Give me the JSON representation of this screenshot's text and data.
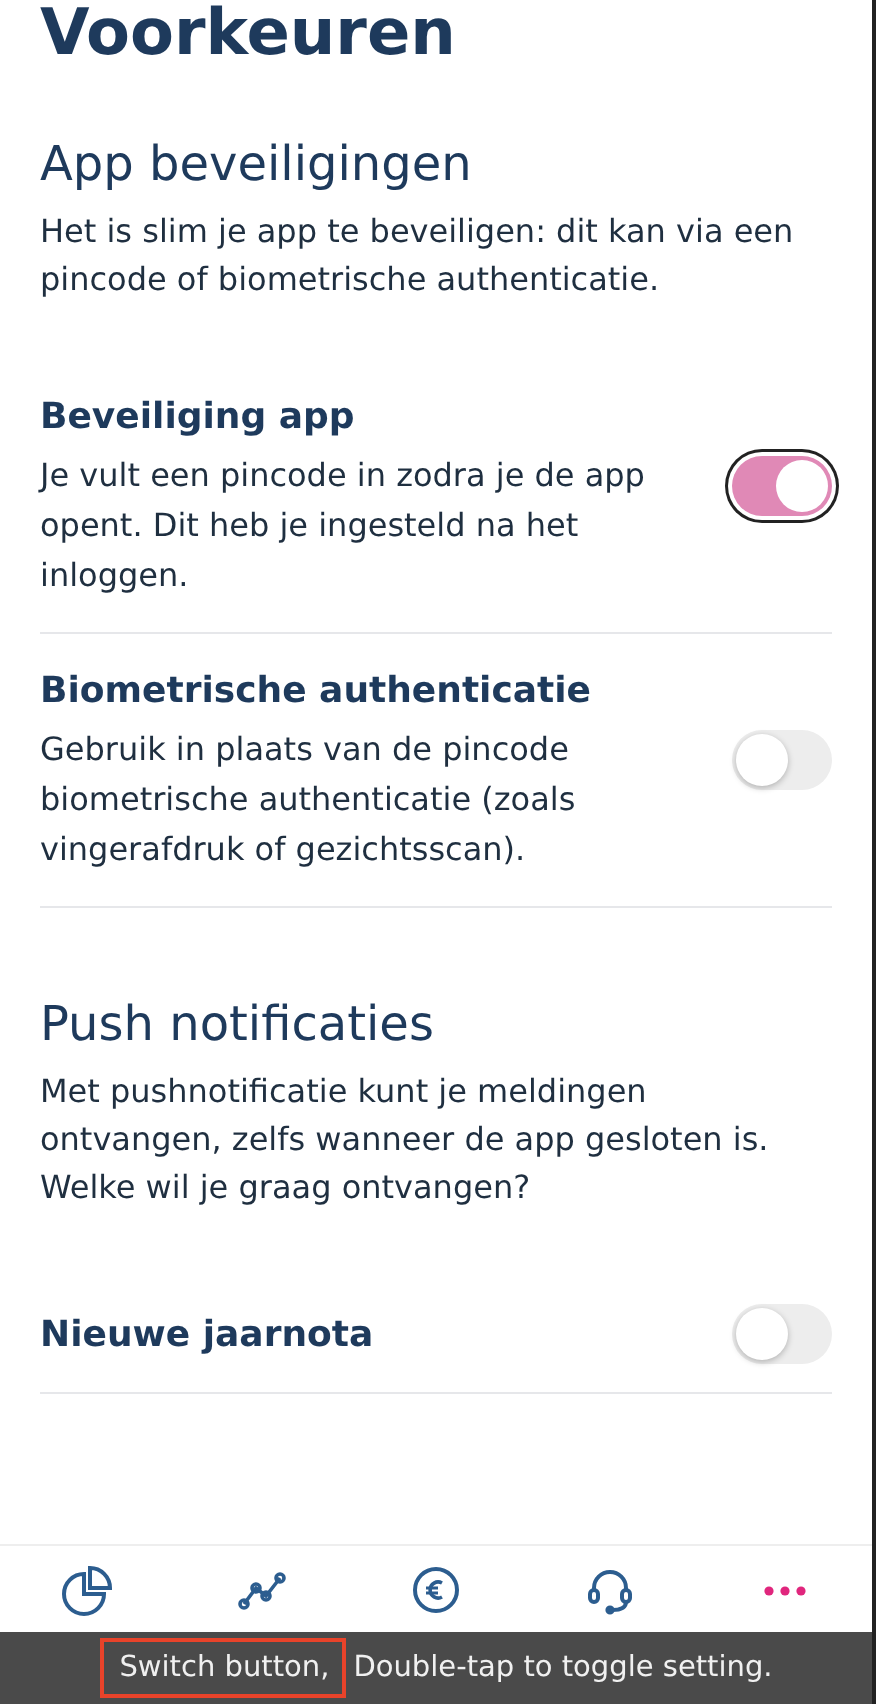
{
  "page_title": "Voorkeuren",
  "sections": [
    {
      "heading": "App beveiligingen",
      "intro": "Het is slim je app te beveiligen: dit kan via een pincode of biometrische authenticatie.",
      "settings": [
        {
          "title": "Beveiliging app",
          "description": "Je vult een pincode in zodra je de app opent. Dit heb je ingesteld na het inloggen.",
          "on": true,
          "focused": true
        },
        {
          "title": "Biometrische authenticatie",
          "description": "Gebruik in plaats van de pincode biometrische authenticatie (zoals vingerafdruk of gezichtsscan).",
          "on": false,
          "focused": false
        }
      ]
    },
    {
      "heading": "Push notificaties",
      "intro": "Met pushnotificatie kunt je meldingen ontvangen, zelfs wanneer de app gesloten is. Welke wil je graag ontvangen?",
      "settings": [
        {
          "title": "Nieuwe jaarnota",
          "on": false,
          "focused": false
        }
      ]
    }
  ],
  "tab_bar": [
    {
      "kind": "pie",
      "selected": false
    },
    {
      "kind": "graph",
      "selected": false
    },
    {
      "kind": "euro",
      "selected": false
    },
    {
      "kind": "headset",
      "selected": false
    },
    {
      "kind": "dots",
      "selected": true
    }
  ],
  "voiceover_caption": {
    "focused_text": "Switch button,",
    "rest": "Double-tap to toggle setting."
  }
}
